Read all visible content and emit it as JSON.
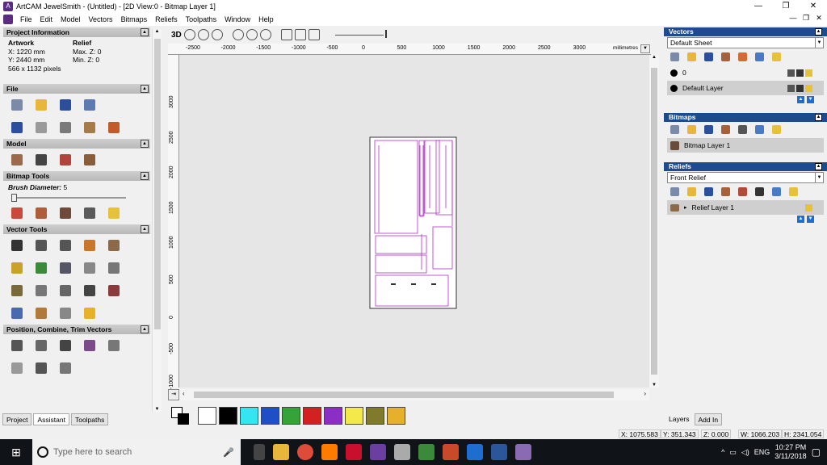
{
  "window": {
    "title": "ArtCAM JewelSmith - (Untitled) - [2D View:0 - Bitmap Layer 1]"
  },
  "menu": [
    "File",
    "Edit",
    "Model",
    "Vectors",
    "Bitmaps",
    "Reliefs",
    "Toolpaths",
    "Window",
    "Help"
  ],
  "left": {
    "project_info": {
      "header": "Project Information",
      "artwork": "Artwork",
      "relief": "Relief",
      "x": "X: 1220 mm",
      "y": "Y: 2440 mm",
      "pixels": "566 x 1132 pixels",
      "maxz": "Max. Z: 0",
      "minz": "Min. Z: 0"
    },
    "file": {
      "header": "File"
    },
    "model": {
      "header": "Model"
    },
    "bitmap_tools": {
      "header": "Bitmap Tools",
      "brush_label": "Brush Diameter:",
      "brush_value": "5"
    },
    "vector_tools": {
      "header": "Vector Tools"
    },
    "position": {
      "header": "Position, Combine, Trim Vectors"
    },
    "tabs": [
      "Project",
      "Assistant",
      "Toolpaths"
    ]
  },
  "view": {
    "label3d": "3D",
    "ruler_top": [
      "-2500",
      "-2000",
      "-1500",
      "-1000",
      "-500",
      "0",
      "500",
      "1000",
      "1500",
      "2000",
      "2500",
      "3000"
    ],
    "ruler_unit": "millimetres",
    "ruler_left": [
      "3000",
      "2500",
      "2000",
      "1500",
      "1000",
      "500",
      "0",
      "-500",
      "-1000"
    ]
  },
  "palette": {
    "colors": [
      "#ffffff",
      "#000000",
      "#33e6f0",
      "#1f4fc4",
      "#35a33a",
      "#d32020",
      "#8a2fc4",
      "#f3ea4a",
      "#807a2c",
      "#e6b12a"
    ]
  },
  "right": {
    "vectors": {
      "header": "Vectors",
      "sheet": "Default Sheet",
      "layers": [
        {
          "name": "0"
        },
        {
          "name": "Default Layer"
        }
      ]
    },
    "bitmaps": {
      "header": "Bitmaps",
      "layer": "Bitmap Layer 1"
    },
    "reliefs": {
      "header": "Reliefs",
      "selected": "Front Relief",
      "layer": "Relief Layer 1"
    },
    "tabs": [
      "Layers",
      "Add In"
    ]
  },
  "status": {
    "x": "X: 1075.583",
    "y": "Y: 351.343",
    "z": "Z: 0.000",
    "w": "W: 1066.203",
    "h": "H: 2341.054"
  },
  "taskbar": {
    "search_placeholder": "Type here to search",
    "lang": "ENG",
    "time": "10:27 PM",
    "date": "3/11/2018"
  }
}
